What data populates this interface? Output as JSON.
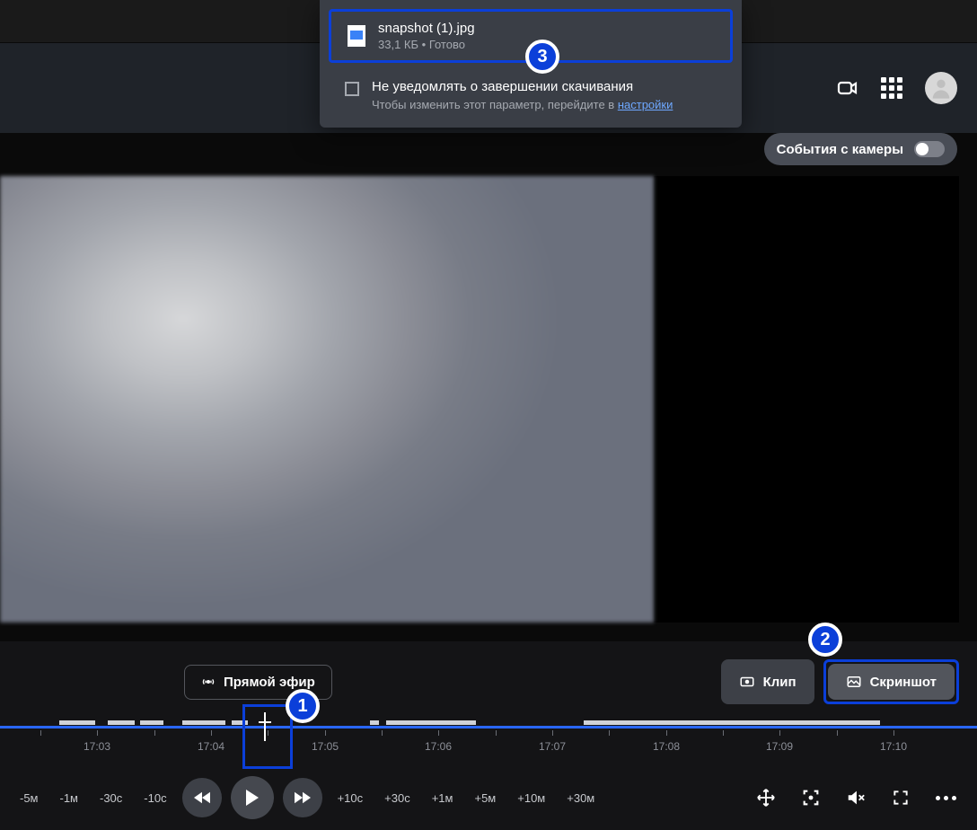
{
  "download": {
    "filename": "snapshot (1).jpg",
    "size": "33,1 КБ",
    "status": "Готово",
    "separator": " • "
  },
  "notification": {
    "title": "Не уведомлять о завершении скачивания",
    "subtitle_prefix": "Чтобы изменить этот параметр, перейдите в ",
    "settings_link": "настройки"
  },
  "events_toggle": {
    "label": "События с камеры"
  },
  "actions": {
    "live": "Прямой эфир",
    "clip": "Клип",
    "screenshot": "Скриншот"
  },
  "timeline": {
    "labels": [
      "17:03",
      "17:04",
      "17:05",
      "17:06",
      "17:07",
      "17:08",
      "17:09",
      "17:10"
    ]
  },
  "skips": {
    "back": [
      "-5м",
      "-1м",
      "-30с",
      "-10с"
    ],
    "fwd": [
      "+10с",
      "+30с",
      "+1м",
      "+5м",
      "+10м",
      "+30м"
    ]
  },
  "badges": {
    "b1": "1",
    "b2": "2",
    "b3": "3"
  }
}
